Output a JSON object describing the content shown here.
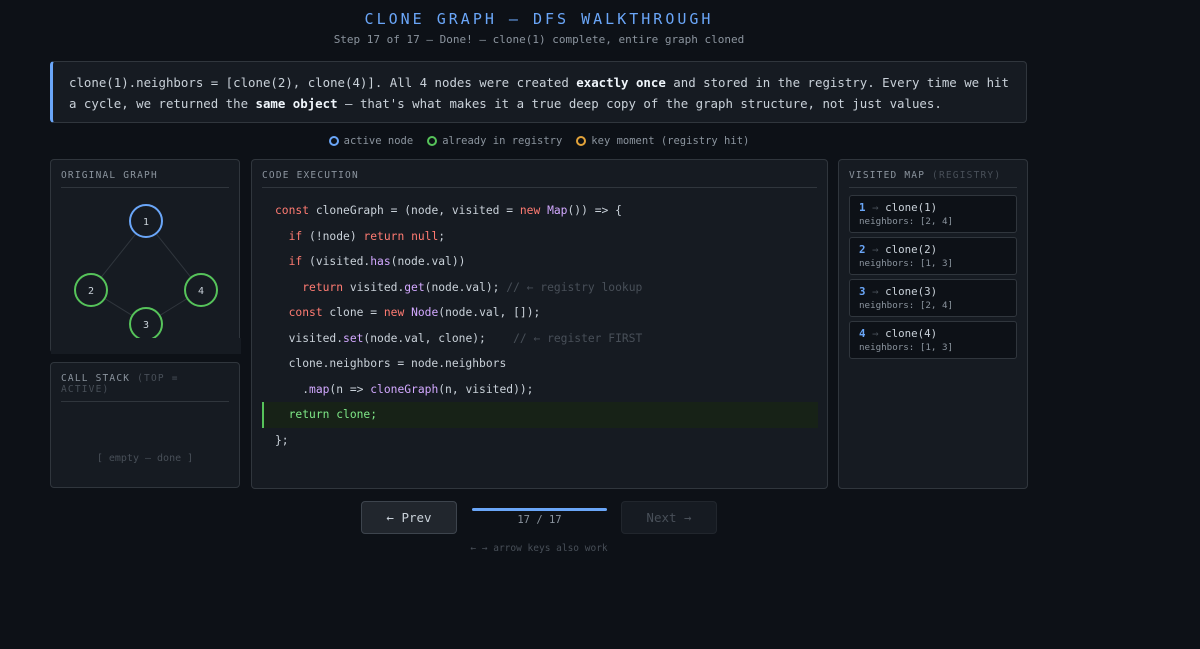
{
  "header": {
    "title": "CLONE GRAPH — DFS WALKTHROUGH",
    "subtitle": "Step 17 of 17 — Done! — clone(1) complete, entire graph cloned"
  },
  "explanation": {
    "p1": "clone(1).neighbors = [clone(2), clone(4)]. All 4 nodes were created ",
    "b1": "exactly once",
    "p2": " and stored in the registry. Every time we hit a cycle, we returned the ",
    "b2": "same object",
    "p3": " — that's what makes it a true deep copy of the graph structure, not just values."
  },
  "legend": [
    {
      "label": "active node",
      "color": "#6aa6f8"
    },
    {
      "label": "already in registry",
      "color": "#56c35a"
    },
    {
      "label": "key moment (registry hit)",
      "color": "#e3a33a"
    }
  ],
  "graph_panel": {
    "title": "ORIGINAL GRAPH",
    "nodes": [
      {
        "label": "1",
        "state": "active"
      },
      {
        "label": "2",
        "state": "registry"
      },
      {
        "label": "3",
        "state": "registry"
      },
      {
        "label": "4",
        "state": "registry"
      }
    ]
  },
  "stack_panel": {
    "title": "CALL STACK",
    "title_dim": "(TOP = ACTIVE)",
    "empty_text": "[ empty — done ]"
  },
  "code_panel": {
    "title": "CODE EXECUTION",
    "active_line": 9
  },
  "visited_panel": {
    "title": "VISITED MAP",
    "title_dim": "(REGISTRY)",
    "entries": [
      {
        "key": "1",
        "value": "clone(1)",
        "neighbors": "neighbors: [2, 4]"
      },
      {
        "key": "2",
        "value": "clone(2)",
        "neighbors": "neighbors: [1, 3]"
      },
      {
        "key": "3",
        "value": "clone(3)",
        "neighbors": "neighbors: [2, 4]"
      },
      {
        "key": "4",
        "value": "clone(4)",
        "neighbors": "neighbors: [1, 3]"
      }
    ]
  },
  "controls": {
    "prev_label": "← Prev",
    "next_label": "Next →",
    "counter": "17 / 17",
    "progress": 1.0,
    "hint": "← → arrow keys also work"
  },
  "colors": {
    "active": "#6aa6f8",
    "registry": "#56c35a",
    "key": "#e3a33a"
  }
}
